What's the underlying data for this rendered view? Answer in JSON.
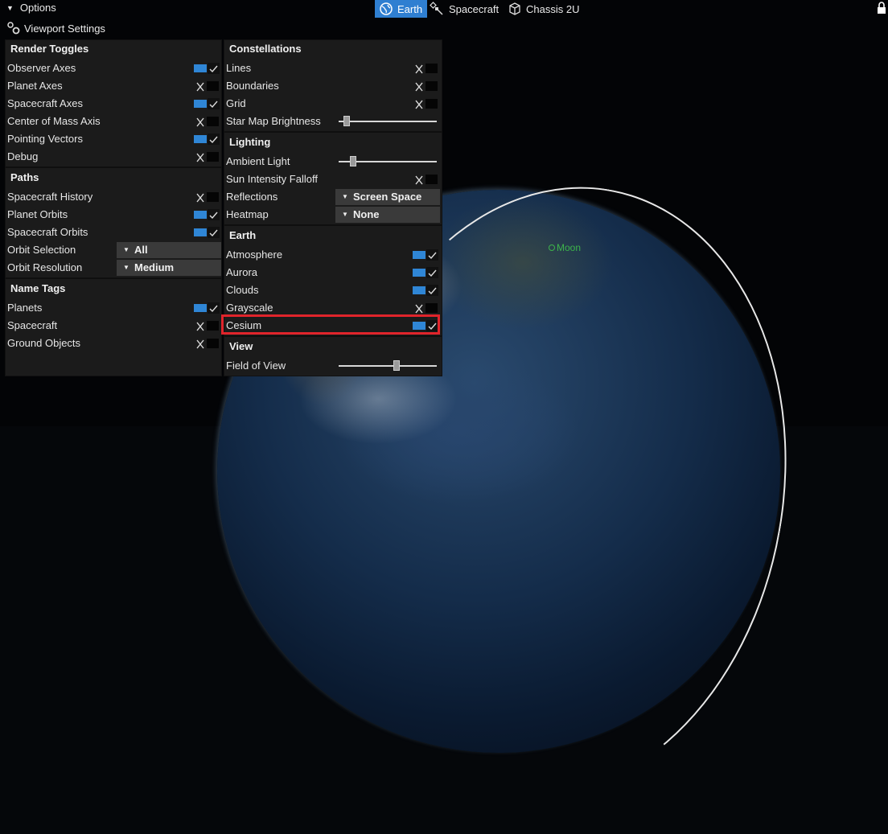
{
  "topbar": {
    "options_label": "Options",
    "tabs": [
      {
        "label": "Earth",
        "icon": "globe-icon",
        "active": true
      },
      {
        "label": "Spacecraft",
        "icon": "satellite-icon",
        "active": false
      },
      {
        "label": "Chassis 2U",
        "icon": "cube-icon",
        "active": false
      }
    ],
    "lock_icon": "lock-icon"
  },
  "viewport_settings_label": "Viewport Settings",
  "render_toggles": {
    "title": "Render Toggles",
    "items": [
      {
        "label": "Observer Axes",
        "on": true
      },
      {
        "label": "Planet Axes",
        "on": false
      },
      {
        "label": "Spacecraft Axes",
        "on": true
      },
      {
        "label": "Center of Mass Axis",
        "on": false
      },
      {
        "label": "Pointing Vectors",
        "on": true
      },
      {
        "label": "Debug",
        "on": false
      }
    ]
  },
  "paths": {
    "title": "Paths",
    "items": [
      {
        "label": "Spacecraft History",
        "on": false
      },
      {
        "label": "Planet Orbits",
        "on": true
      },
      {
        "label": "Spacecraft Orbits",
        "on": true
      }
    ],
    "orbit_selection": {
      "label": "Orbit Selection",
      "value": "All"
    },
    "orbit_resolution": {
      "label": "Orbit Resolution",
      "value": "Medium"
    }
  },
  "name_tags": {
    "title": "Name Tags",
    "items": [
      {
        "label": "Planets",
        "on": true
      },
      {
        "label": "Spacecraft",
        "on": false
      },
      {
        "label": "Ground Objects",
        "on": false
      }
    ]
  },
  "constellations": {
    "title": "Constellations",
    "items": [
      {
        "label": "Lines",
        "on": false
      },
      {
        "label": "Boundaries",
        "on": false
      },
      {
        "label": "Grid",
        "on": false
      }
    ],
    "star_map_brightness": {
      "label": "Star Map Brightness",
      "level": 0.05
    }
  },
  "lighting": {
    "title": "Lighting",
    "ambient_light": {
      "label": "Ambient Light",
      "level": 0.12
    },
    "sun_intensity_falloff": {
      "label": "Sun Intensity Falloff",
      "on": false
    },
    "reflections": {
      "label": "Reflections",
      "value": "Screen Space"
    },
    "heatmap": {
      "label": "Heatmap",
      "value": "None"
    }
  },
  "earth": {
    "title": "Earth",
    "items": [
      {
        "label": "Atmosphere",
        "on": true
      },
      {
        "label": "Aurora",
        "on": true
      },
      {
        "label": "Clouds",
        "on": true
      },
      {
        "label": "Grayscale",
        "on": false
      },
      {
        "label": "Cesium",
        "on": true
      }
    ]
  },
  "view": {
    "title": "View",
    "field_of_view": {
      "label": "Field of View",
      "level": 0.6
    }
  },
  "scene": {
    "moon_label": "Moon"
  },
  "colors": {
    "accent": "#2f7fd1",
    "toggle_on": "#2f86d6",
    "highlight": "#e0242b",
    "moon": "#3cb44b"
  }
}
